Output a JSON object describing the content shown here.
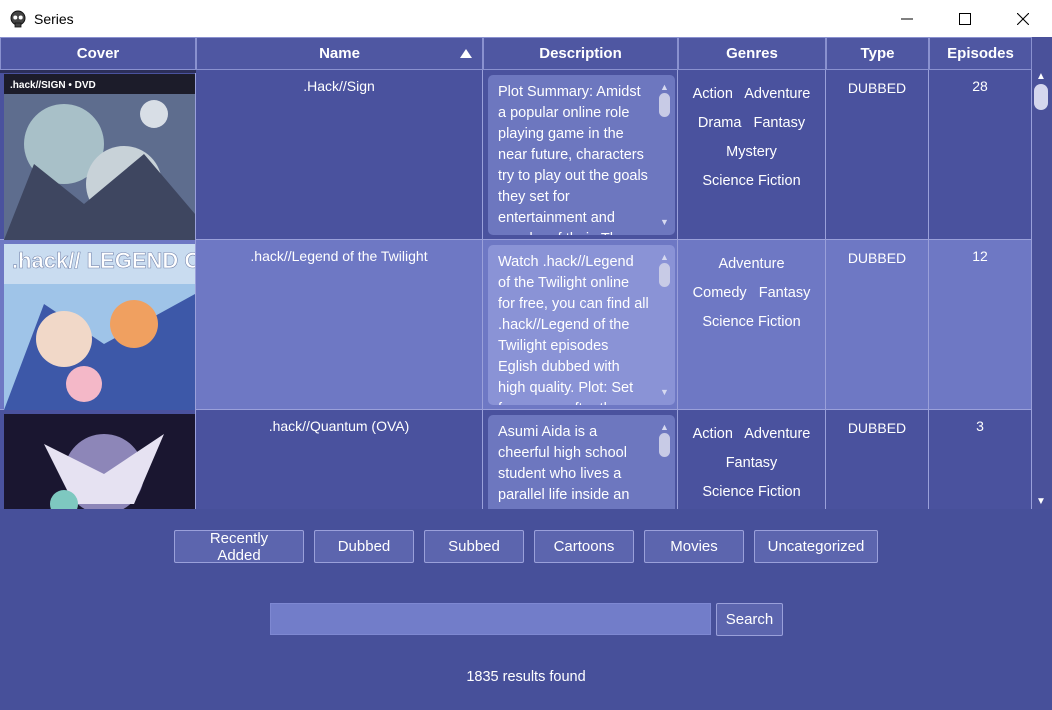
{
  "window": {
    "title": "Series"
  },
  "table": {
    "columns": [
      "Cover",
      "Name",
      "Description",
      "Genres",
      "Type",
      "Episodes"
    ],
    "sorted_column": "Name",
    "rows": [
      {
        "name": ".Hack//Sign",
        "description": "Plot Summary: Amidst a popular online role playing game in the near future, characters try to play out the goals they set for entertainment and wonder of their. They",
        "genres": [
          "Action",
          "Adventure",
          "Drama",
          "Fantasy",
          "Mystery",
          "Science Fiction"
        ],
        "type": "DUBBED",
        "episodes": "28",
        "cover_text": ".hack//SIGN • DVD"
      },
      {
        "name": ".hack//Legend of the Twilight",
        "description": "Watch .hack//Legend of the Twilight online for free, you can find all .hack//Legend of the Twilight episodes Eglish dubbed with high quality. Plot: Set four years after the",
        "genres": [
          "Adventure",
          "Comedy",
          "Fantasy",
          "Science Fiction"
        ],
        "type": "DUBBED",
        "episodes": "12",
        "cover_text": ".hack// LEGEND OF THE TWILIGHT"
      },
      {
        "name": ".hack//Quantum (OVA)",
        "description": "Asumi Aida is a cheerful high school student who lives a parallel life inside an online game",
        "genres": [
          "Action",
          "Adventure",
          "Fantasy",
          "Science Fiction"
        ],
        "type": "DUBBED",
        "episodes": "3",
        "cover_text": ""
      }
    ]
  },
  "categories": [
    "Recently Added",
    "Dubbed",
    "Subbed",
    "Cartoons",
    "Movies",
    "Uncategorized"
  ],
  "search": {
    "value": "",
    "placeholder": "",
    "button_label": "Search"
  },
  "status": {
    "results_text": "1835 results found"
  }
}
